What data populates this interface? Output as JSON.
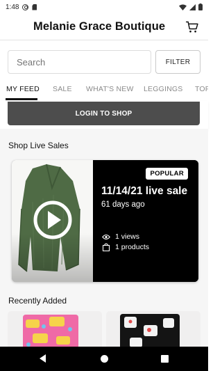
{
  "status_bar": {
    "time": "1:48"
  },
  "header": {
    "title": "Melanie Grace Boutique"
  },
  "search": {
    "placeholder": "Search",
    "filter_label": "FILTER"
  },
  "tabs": [
    {
      "label": "MY FEED",
      "active": true
    },
    {
      "label": "SALE",
      "active": false
    },
    {
      "label": "WHAT'S NEW",
      "active": false
    },
    {
      "label": "LEGGINGS",
      "active": false
    },
    {
      "label": "TOP",
      "active": false
    }
  ],
  "login": {
    "label": "LOGIN TO SHOP"
  },
  "live_sales": {
    "section_title": "Shop Live Sales",
    "card": {
      "badge": "POPULAR",
      "title": "11/14/21 live sale",
      "age": "61 days ago",
      "views": "1 views",
      "products": "1 products"
    }
  },
  "recently_added": {
    "section_title": "Recently Added"
  },
  "colors": {
    "accent": "#4d4d4d",
    "card_bg": "#000000",
    "sweater": "#4f6b45"
  },
  "icons": [
    "cart-icon",
    "play-icon",
    "eye-icon",
    "bag-icon"
  ]
}
